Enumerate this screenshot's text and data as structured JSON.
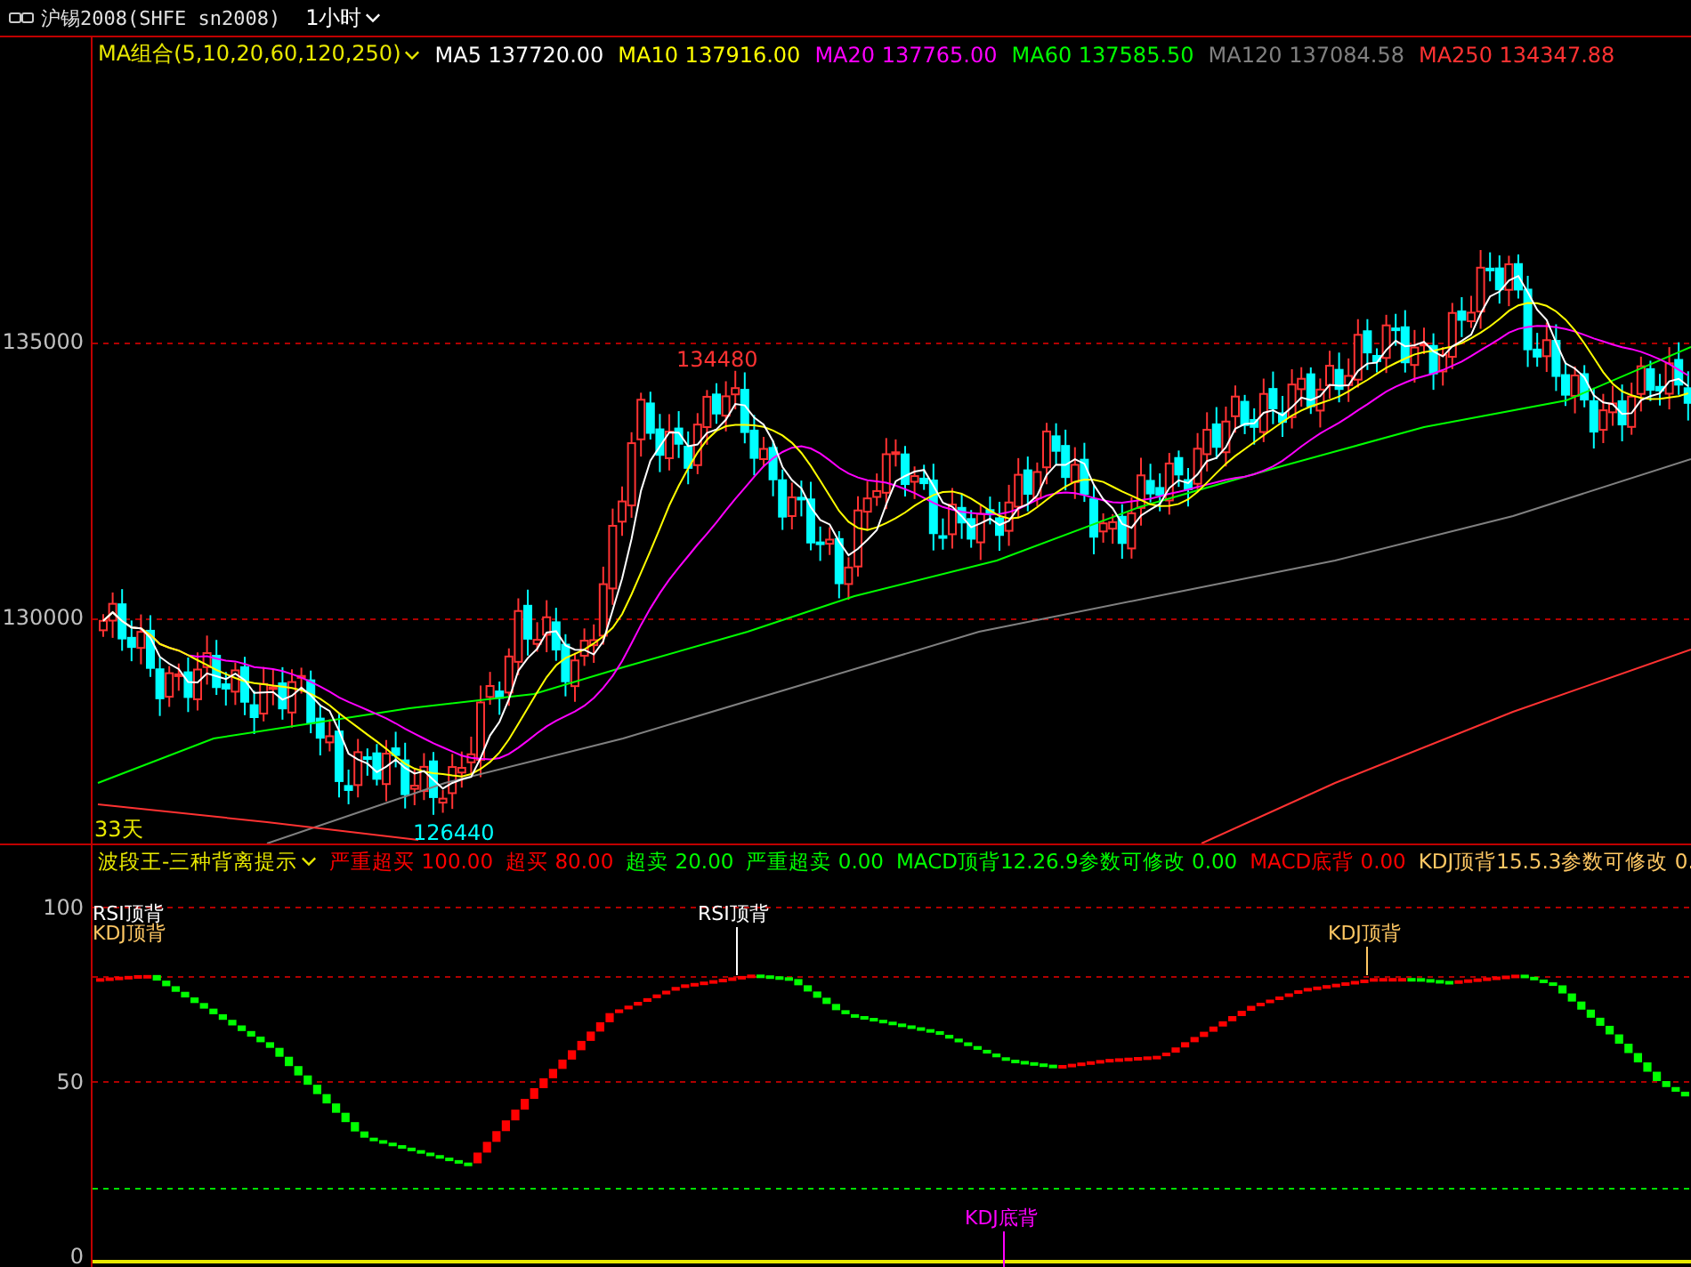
{
  "title_bar": {
    "symbol": "沪锡2008(SHFE sn2008)",
    "period": "1小时"
  },
  "price_panel": {
    "indicator_name": "MA组合(5,10,20,60,120,250)",
    "legend": [
      {
        "label": "MA5 137720.00",
        "color": "#ffffff"
      },
      {
        "label": "MA10 137916.00",
        "color": "#ffff00"
      },
      {
        "label": "MA20 137765.00",
        "color": "#ff00ff"
      },
      {
        "label": "MA60 137585.50",
        "color": "#00ff00"
      },
      {
        "label": "MA120 137084.58",
        "color": "#808080"
      },
      {
        "label": "MA250 134347.88",
        "color": "#ff3232"
      }
    ],
    "y_axis_labels": [
      "135000",
      "130000"
    ],
    "high_label": "134480",
    "low_label": "126440",
    "range_label": "33天"
  },
  "indicator_panel": {
    "indicator_name": "波段王-三种背离提示",
    "legend": [
      {
        "label": "严重超买 100.00",
        "color": "#ff0000"
      },
      {
        "label": "超买 80.00",
        "color": "#ff0000"
      },
      {
        "label": "超卖 20.00",
        "color": "#00ff00"
      },
      {
        "label": "严重超卖 0.00",
        "color": "#00ff00"
      },
      {
        "label": "MACD顶背12.26.9参数可修改 0.00",
        "color": "#00ff00"
      },
      {
        "label": "MACD底背 0.00",
        "color": "#ff0000"
      },
      {
        "label": "KDJ顶背15.5.3参数可修改 0.",
        "color": "#ffc864"
      }
    ],
    "y_axis_labels": [
      "100",
      "50",
      "0"
    ],
    "signals": [
      {
        "label": "RSI顶背",
        "color": "#ffffff"
      },
      {
        "label": "KDJ顶背",
        "color": "#ffc864"
      },
      {
        "label": "RSI顶背",
        "color": "#ffffff"
      },
      {
        "label": "KDJ顶背",
        "color": "#ffc864"
      },
      {
        "label": "KDJ底背",
        "color": "#ff00ff"
      }
    ]
  }
}
